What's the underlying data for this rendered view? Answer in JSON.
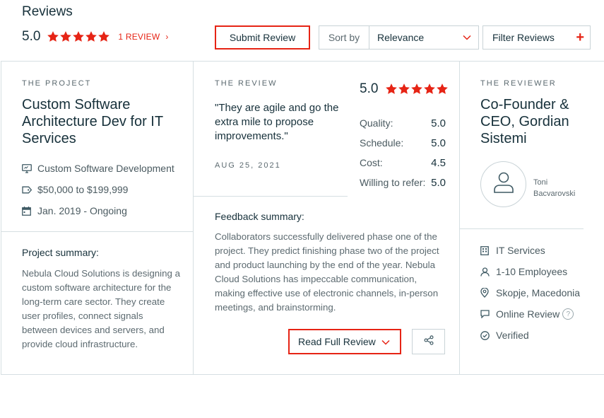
{
  "header": {
    "title": "Reviews",
    "rating": "5.0",
    "review_count": "1 REVIEW",
    "chevron": "›",
    "submit_label": "Submit Review",
    "sort_label": "Sort by",
    "sort_value": "Relevance",
    "filter_label": "Filter Reviews",
    "filter_icon": "+"
  },
  "project": {
    "eyebrow": "THE PROJECT",
    "title": "Custom Software Architecture Dev for IT Services",
    "service": "Custom Software Development",
    "budget": "$50,000 to $199,999",
    "dates": "Jan. 2019 - Ongoing",
    "summary_label": "Project summary:",
    "summary": "Nebula Cloud Solutions is designing a custom software architecture for the long-term care sector. They create user profiles, connect signals between devices and servers, and provide cloud infrastructure."
  },
  "review": {
    "eyebrow": "THE REVIEW",
    "quote": "\"They are agile and go the extra mile to propose improvements.\"",
    "date": "AUG 25, 2021",
    "overall": "5.0",
    "scores": [
      {
        "label": "Quality:",
        "value": "5.0"
      },
      {
        "label": "Schedule:",
        "value": "5.0"
      },
      {
        "label": "Cost:",
        "value": "4.5"
      },
      {
        "label": "Willing to refer:",
        "value": "5.0"
      }
    ],
    "feedback_label": "Feedback summary:",
    "feedback": "Collaborators successfully delivered phase one of the project. They predict finishing phase two of the project and product launching by the end of the year. Nebula Cloud Solutions has impeccable communication, making effective use of electronic channels, in-person meetings, and brainstorming.",
    "read_label": "Read Full Review"
  },
  "reviewer": {
    "eyebrow": "THE REVIEWER",
    "title": "Co-Founder & CEO, Gordian Sistemi",
    "name": "Toni Bacvarovski",
    "industry": "IT Services",
    "size": "1-10 Employees",
    "location": "Skopje, Macedonia",
    "review_type": "Online Review",
    "help": "?",
    "verified": "Verified"
  },
  "colors": {
    "accent": "#e62415",
    "text": "#17313b",
    "muted": "#5c6a70",
    "border": "#d6dfe2",
    "icon": "#3f5a64"
  },
  "star_rating": 5
}
